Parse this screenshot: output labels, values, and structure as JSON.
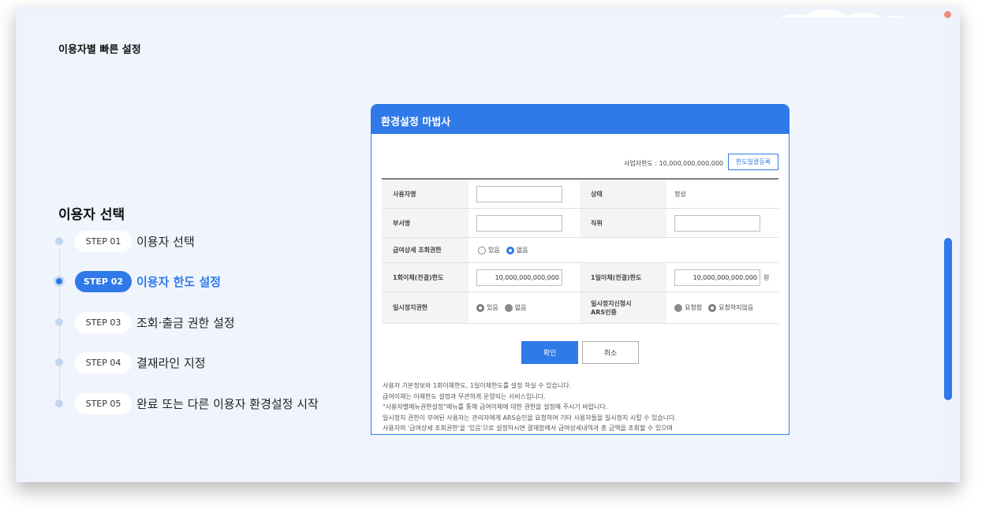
{
  "page": {
    "title": "이용자별 빠른 설정"
  },
  "section": {
    "title": "이용자 선택"
  },
  "steps": [
    {
      "code": "STEP 01",
      "label": "이용자 선택",
      "active": false
    },
    {
      "code": "STEP 02",
      "label": "이용자 한도 설정",
      "active": true
    },
    {
      "code": "STEP 03",
      "label": "조회·출금 권한 설정",
      "active": false
    },
    {
      "code": "STEP 04",
      "label": "결재라인 지정",
      "active": false
    },
    {
      "code": "STEP 05",
      "label": "완료 또는 다른 이용자 환경설정 시작",
      "active": false
    }
  ],
  "wizard": {
    "title": "환경설정 마법사",
    "limit_label": "사업자한도 : 10,000,000,000,000",
    "limit_button": "한도일괄등록",
    "fields": {
      "user_name": "사용자명",
      "status": "상태",
      "status_value": "정상",
      "dept": "부서명",
      "position": "직위",
      "salary_view": "급여상세 조회권한",
      "salary_opt_yes": "있음",
      "salary_opt_no": "없음",
      "per_transfer": "1회이체(전결)한도",
      "per_transfer_value": "10,000,000,000,000",
      "daily_transfer": "1일이체(전결)한도",
      "daily_transfer_value": "10,000,000,000,000",
      "won": "원",
      "suspend": "일시정지권한",
      "suspend_yes": "있음",
      "suspend_no": "없음",
      "suspend_ars_1": "일시정지신청시",
      "suspend_ars_2": "ARS인증",
      "ars_req": "요청함",
      "ars_noreq": "요청하지않음"
    },
    "ok_button": "확인",
    "cancel_button": "취소",
    "notes": [
      "사용자 기본정보와 1회이체한도, 1일이체한도를 설정 하실 수 있습니다.",
      "급여이체는 이체한도 설정과 무관하게 운영되는 서비스입니다.",
      "\"사용자별메뉴권한설정\"메뉴를 통해 급여이체에 대한 권한을 설정해 주시기 바랍니다.",
      "일시정지 권한이 부여된 사용자는 관리자에게 ARS승인을 요청하여 기타 사용자들을 일시정지 시킬 수 있습니다.",
      "사용자의 '급여상세 조회권한'을 '있음'으로 설정하시면 결재함에서 급여상세내역과 총 금액을 조회할 수 있으며"
    ]
  },
  "colors": {
    "accent": "#2f79e8",
    "background": "#f0f5fd"
  }
}
